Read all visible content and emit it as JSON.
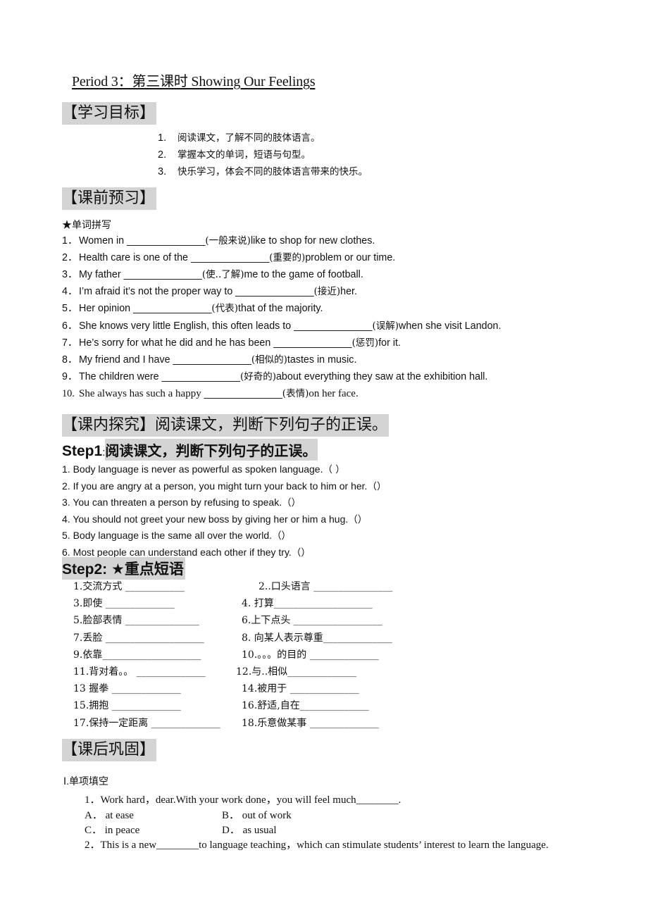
{
  "title": "Period 3：第三课时  Showing Our Feelings",
  "sections": {
    "goals": {
      "heading": "【学习目标】",
      "items": [
        {
          "num": "1.",
          "text": "阅读课文，了解不同的肢体语言。"
        },
        {
          "num": "2.",
          "text": "掌握本文的单词，短语与句型。"
        },
        {
          "num": "3.",
          "text": "快乐学习，体会不同的肢体语言带来的快乐。"
        }
      ]
    },
    "preview": {
      "heading": "【课前预习】",
      "subheading": "★单词拼写",
      "items": [
        {
          "num": "1．",
          "before": "Women in ",
          "blank": "______________",
          "hint": "(一般来说)",
          "after": "like to shop for new clothes."
        },
        {
          "num": "2．",
          "before": "Health care is one of the ",
          "blank": "______________",
          "hint": "(重要的)",
          "after": "problem or our time."
        },
        {
          "num": "3．",
          "before": "My father ",
          "blank": "______________",
          "hint": "(使..了解)",
          "after": "me to the game of football."
        },
        {
          "num": "4．",
          "before": "I’m afraid it’s not the proper way to ",
          "blank": "______________",
          "hint": "(接近)",
          "after": "her."
        },
        {
          "num": "5．",
          "before": "Her opinion ",
          "blank": "______________",
          "hint": "(代表)",
          "after": "that of the majority."
        },
        {
          "num": "6．",
          "before": "She knows very little English, this often leads to ",
          "blank": "______________",
          "hint": "(误解)",
          "after": "when she visit Landon."
        },
        {
          "num": "7．",
          "before": "He’s sorry for what he did and he has been ",
          "blank": "______________",
          "hint": "(惩罚)",
          "after": "for it."
        },
        {
          "num": "8．",
          "before": "My friend and I have ",
          "blank": "______________",
          "hint": "(相似的)",
          "after": "tastes in music."
        },
        {
          "num": "9．",
          "before": "The children were ",
          "blank": "______________",
          "hint": "(好奇的)",
          "after": "about everything they saw at the exhibition hall."
        },
        {
          "num": "10.",
          "before": "She always has such a happy ",
          "blank": "______________",
          "hint": "(表情)",
          "after": "on her face."
        }
      ]
    },
    "explore": {
      "heading": "【课内探究】阅读课文，判断下列句子的正误。",
      "step1": {
        "label": "Step1",
        "colon": ":",
        "title": " 阅读课文，判断下列句子的正误。",
        "items": [
          {
            "text": "1. Body language is never as powerful as spoken language.",
            "paren": "（  ）"
          },
          {
            "text": "2. If you are angry at a person, you might turn your back to him or her.",
            "paren": "（）"
          },
          {
            "text": "3. You can threaten a person by refusing to speak.",
            "paren": "（）"
          },
          {
            "text": "4. You should not greet your new boss by giving her or him a hug.",
            "paren": "（）"
          },
          {
            "text": "5. Body language is the same all over the world.",
            "paren": "（）"
          },
          {
            "text": "6. Most people can understand each other if they try.",
            "paren": "（）"
          }
        ]
      },
      "step2": {
        "label": "Step2: ★重点短语",
        "phrases": [
          {
            "left": "1.交流方式 ____________",
            "right": "2..口头语言 ________________"
          },
          {
            "left": "3.即使   ______________",
            "right": "4. 打算____________________"
          },
          {
            "left": "5.脸部表情 _______________",
            "right": "6.上下点头 __________________"
          },
          {
            "left": "7.丢脸 ____________________",
            "right": "8. 向某人表示尊重______________"
          },
          {
            "left": "9.依靠____________________",
            "right": "10.。。。的目的 ______________"
          },
          {
            "left": "11.背对着。。  ______________",
            "right": "12.与..相似______________"
          },
          {
            "left": "13 握拳 ______________",
            "right": "14.被用于 ______________"
          },
          {
            "left": "15.拥抱 ______________",
            "right": "16.舒适,自在______________"
          },
          {
            "left": "17.保持一定距离 ______________",
            "right": "18.乐意做某事 ______________"
          }
        ]
      }
    },
    "consolidate": {
      "heading": "【课后巩固】",
      "part_label": "Ⅰ.单项填空",
      "questions": [
        {
          "text": "1．Work hard，dear.With your work done，you will feel much________.",
          "options": [
            "A． at ease",
            "B． out of work",
            "C． in peace",
            "D． as usual"
          ]
        },
        {
          "text": "2．This is a new________to language teaching，which can stimulate students’ interest to learn the language.",
          "options": []
        }
      ]
    }
  }
}
